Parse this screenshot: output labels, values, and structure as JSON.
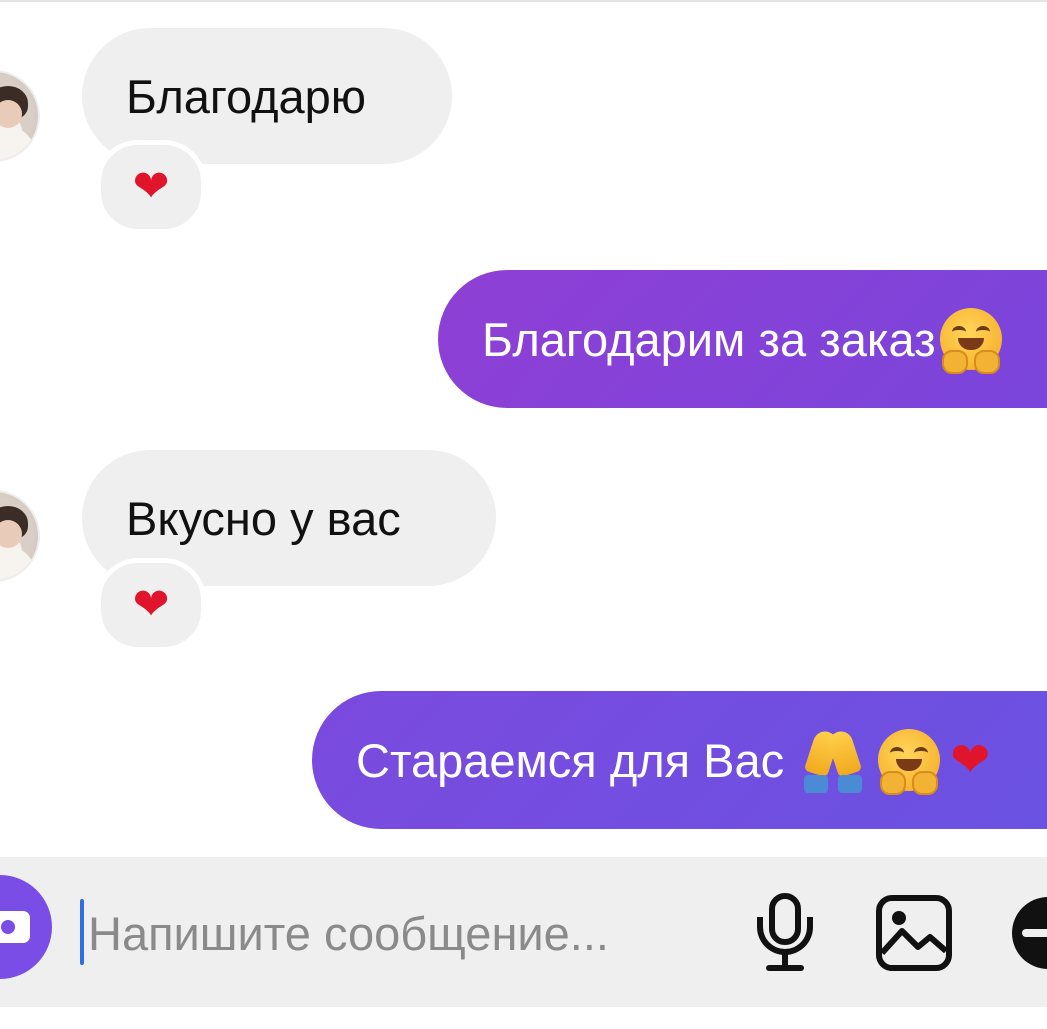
{
  "messages": [
    {
      "direction": "incoming",
      "text": "Благодарю",
      "reaction": "❤"
    },
    {
      "direction": "outgoing",
      "text": "Благодарим за заказ",
      "trailing_emoji": [
        "hugging-face"
      ]
    },
    {
      "direction": "incoming",
      "text": "Вкусно у вас",
      "reaction": "❤"
    },
    {
      "direction": "outgoing",
      "text": "Стараемся для Вас",
      "trailing_emoji": [
        "folded-hands",
        "hugging-face",
        "red-heart"
      ]
    }
  ],
  "composer": {
    "placeholder": "Напишите сообщение...",
    "value": "",
    "icons": [
      "camera-icon",
      "microphone-icon",
      "gallery-icon",
      "more-icon"
    ]
  },
  "colors": {
    "incoming_bubble": "#efefef",
    "outgoing_gradient_top": "#8b3fd6",
    "outgoing_gradient_bottom": "#6a4fe0",
    "camera_button": "#7a4ee6",
    "caret": "#2f6ee0",
    "heart": "#e0142b"
  }
}
